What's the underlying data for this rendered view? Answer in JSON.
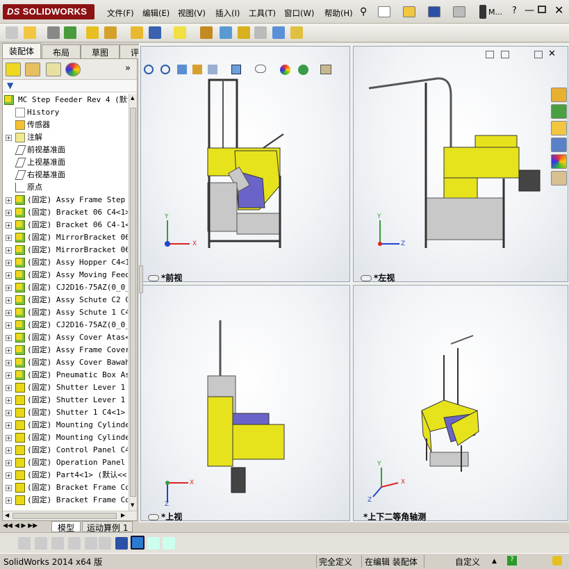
{
  "app": {
    "logo_text": "SOLIDWORKS",
    "logo_prefix": "DS"
  },
  "menu": [
    "文件(F)",
    "编辑(E)",
    "视图(V)",
    "插入(I)",
    "工具(T)",
    "窗口(W)",
    "帮助(H)"
  ],
  "title_short": "M...",
  "tabs": [
    "装配体",
    "布局",
    "草图",
    "评估"
  ],
  "tree": {
    "root": "MC Step Feeder Rev 4  (默认",
    "items": [
      {
        "label": "History",
        "icon": "history-icon",
        "exp": false
      },
      {
        "label": "传感器",
        "icon": "sensor-icon",
        "exp": false
      },
      {
        "label": "注解",
        "icon": "annotation-icon",
        "exp": true
      },
      {
        "label": "前视基准面",
        "icon": "plane-icon",
        "exp": false
      },
      {
        "label": "上视基准面",
        "icon": "plane-icon",
        "exp": false
      },
      {
        "label": "右视基准面",
        "icon": "plane-icon",
        "exp": false
      },
      {
        "label": "原点",
        "icon": "origin-icon",
        "exp": false
      },
      {
        "label": "(固定) Assy Frame Step",
        "icon": "assembly-icon",
        "exp": true
      },
      {
        "label": "(固定) Bracket 06 C4<1>",
        "icon": "assembly-icon",
        "exp": true
      },
      {
        "label": "(固定) Bracket 06 C4-1<",
        "icon": "assembly-icon",
        "exp": true
      },
      {
        "label": "(固定) MirrorBracket 06",
        "icon": "assembly-icon",
        "exp": true
      },
      {
        "label": "(固定) MirrorBracket 06",
        "icon": "assembly-icon",
        "exp": true
      },
      {
        "label": "(固定) Assy Hopper C4<1",
        "icon": "assembly-icon",
        "exp": true
      },
      {
        "label": "(固定) Assy Moving Feed",
        "icon": "assembly-icon",
        "exp": true
      },
      {
        "label": "(固定) CJ2D16-75AZ(0_0_",
        "icon": "assembly-icon",
        "exp": true
      },
      {
        "label": "(固定) Assy Schute C2 C",
        "icon": "assembly-icon",
        "exp": true
      },
      {
        "label": "(固定) Assy Schute 1 C4",
        "icon": "assembly-icon",
        "exp": true
      },
      {
        "label": "(固定) CJ2D16-75AZ(0_0_",
        "icon": "assembly-icon",
        "exp": true
      },
      {
        "label": "(固定) Assy Cover Atas<",
        "icon": "assembly-icon",
        "exp": true
      },
      {
        "label": "(固定) Assy Frame Cover",
        "icon": "assembly-icon",
        "exp": true
      },
      {
        "label": "(固定) Assy Cover Bawah",
        "icon": "assembly-icon",
        "exp": true
      },
      {
        "label": "(固定) Pneumatic Box As",
        "icon": "assembly-icon",
        "exp": true
      },
      {
        "label": "(固定) Shutter Lever 1",
        "icon": "part-icon",
        "exp": true
      },
      {
        "label": "(固定) Shutter Lever 1",
        "icon": "part-icon",
        "exp": true
      },
      {
        "label": "(固定) Shutter 1 C4<1>",
        "icon": "part-icon",
        "exp": true
      },
      {
        "label": "(固定) Mounting Cylinde",
        "icon": "part-icon",
        "exp": true
      },
      {
        "label": "(固定) Mounting Cylinde",
        "icon": "part-icon",
        "exp": true
      },
      {
        "label": "(固定) Control Panel C4",
        "icon": "part-icon",
        "exp": true
      },
      {
        "label": "(固定) Operation Panel",
        "icon": "part-icon",
        "exp": true
      },
      {
        "label": "(固定) Part4<1>  (默认<<",
        "icon": "part-icon",
        "exp": true
      },
      {
        "label": "(固定) Bracket Frame Co",
        "icon": "part-icon",
        "exp": true
      },
      {
        "label": "(固定) Bracket Frame Co",
        "icon": "part-icon",
        "exp": true
      }
    ]
  },
  "views": {
    "front": "*前视",
    "left": "*左视",
    "top": "*上视",
    "iso": "*上下二等角轴测"
  },
  "axes": {
    "x": "X",
    "y": "Y",
    "z": "Z"
  },
  "bottom_tabs": [
    "模型",
    "运动算例 1"
  ],
  "status": {
    "version": "SolidWorks 2014 x64 版",
    "defined": "完全定义",
    "editing": "在编辑 装配体",
    "custom": "自定义"
  },
  "colors": {
    "accent": "#e6e31c",
    "logo": "#8c1214",
    "background": "#d4d0c8"
  }
}
